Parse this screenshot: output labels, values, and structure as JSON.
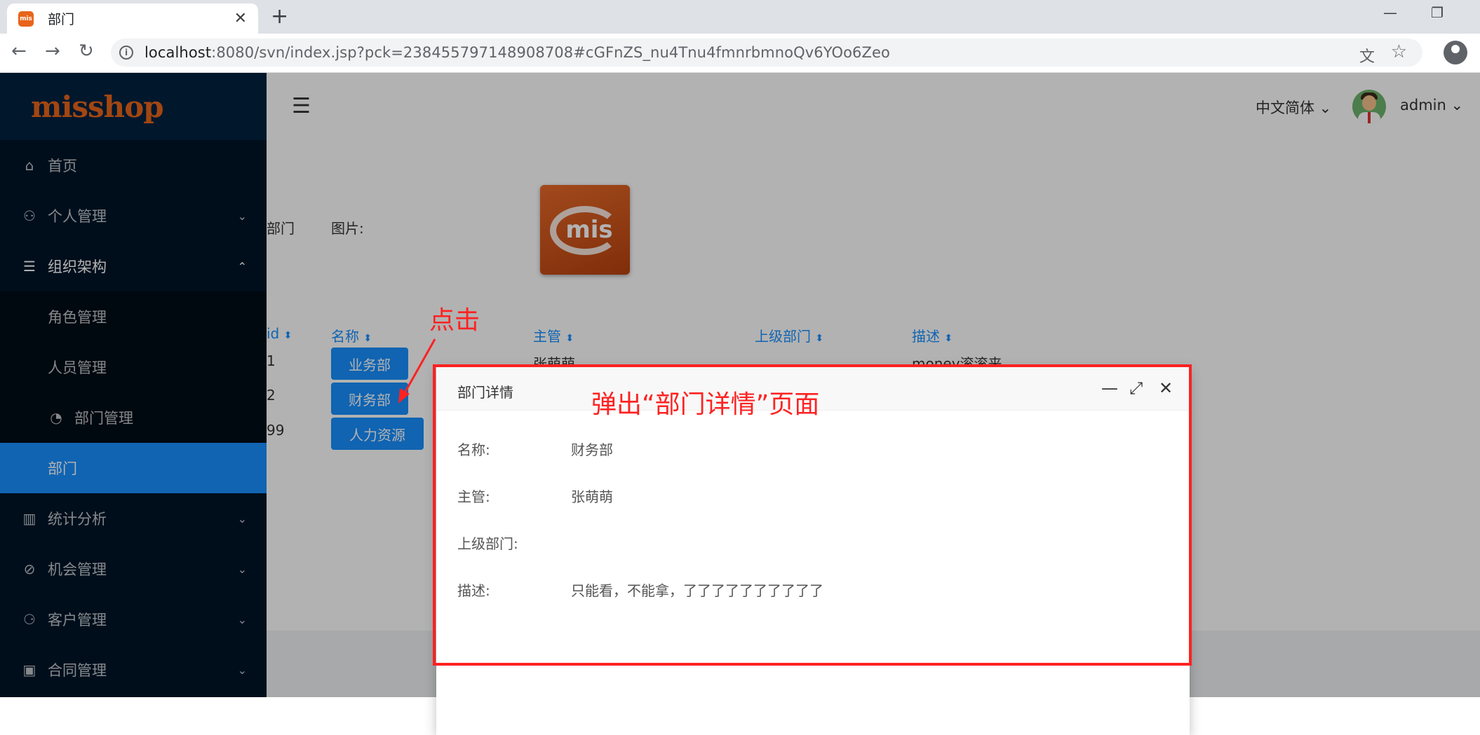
{
  "browser": {
    "tab_title": "部门",
    "favicon_text": "mis",
    "url_host": "localhost",
    "url_rest": ":8080/svn/index.jsp?pck=238455797148908708#cGFnZS_nu4Tnu4fmnrbmnoQv6YOo6Zeo",
    "new_tab": "+",
    "close_tab": "✕",
    "minimize": "—",
    "restore": "❐",
    "back": "←",
    "forward": "→",
    "reload": "↻",
    "info": "i",
    "translate_icon": "文",
    "star": "☆"
  },
  "sidebar": {
    "logo": "misshop",
    "items": [
      {
        "label": "首页",
        "icon": "⌂"
      },
      {
        "label": "个人管理",
        "icon": "⚇",
        "arrow": "⌄"
      },
      {
        "label": "组织架构",
        "icon": "☰",
        "arrow": "⌃"
      },
      {
        "label": "角色管理"
      },
      {
        "label": "人员管理"
      },
      {
        "label": "部门管理",
        "icon": "◔"
      },
      {
        "label": "部门"
      },
      {
        "label": "统计分析",
        "icon": "▥",
        "arrow": "⌄"
      },
      {
        "label": "机会管理",
        "icon": "⊘",
        "arrow": "⌄"
      },
      {
        "label": "客户管理",
        "icon": "⚆",
        "arrow": "⌄"
      },
      {
        "label": "合同管理",
        "icon": "▣",
        "arrow": "⌄"
      }
    ]
  },
  "header": {
    "fold_icon": "☰",
    "language": "中文简体  ⌄",
    "username": "admin  ⌄"
  },
  "panel": {
    "label_dept": "部门",
    "label_image": "图片:",
    "logo_text": "mis",
    "columns": [
      "id",
      "名称",
      "主管",
      "上级部门",
      "描述"
    ],
    "sort_glyph": "⬍",
    "rows": [
      {
        "id": "1",
        "name": "业务部",
        "manager": "张萌萌",
        "desc": "money滚滚来"
      },
      {
        "id": "2",
        "name": "财务部"
      },
      {
        "id": "99",
        "name": "人力资源"
      }
    ]
  },
  "modal": {
    "title": "部门详情",
    "minimize": "—",
    "maximize": "⤢",
    "close": "✕",
    "fields": [
      {
        "label": "名称:",
        "value": "财务部"
      },
      {
        "label": "主管:",
        "value": "张萌萌"
      },
      {
        "label": "上级部门:",
        "value": ""
      },
      {
        "label": "描述:",
        "value": "只能看，不能拿，了了了了了了了了了了"
      }
    ]
  },
  "annotations": {
    "click": "点击",
    "popup": "弹出“部门详情”页面",
    "color": "#ff2222"
  },
  "colors": {
    "primary": "#1890ff",
    "sidebar_bg": "#001529",
    "brand": "#e8651b"
  }
}
